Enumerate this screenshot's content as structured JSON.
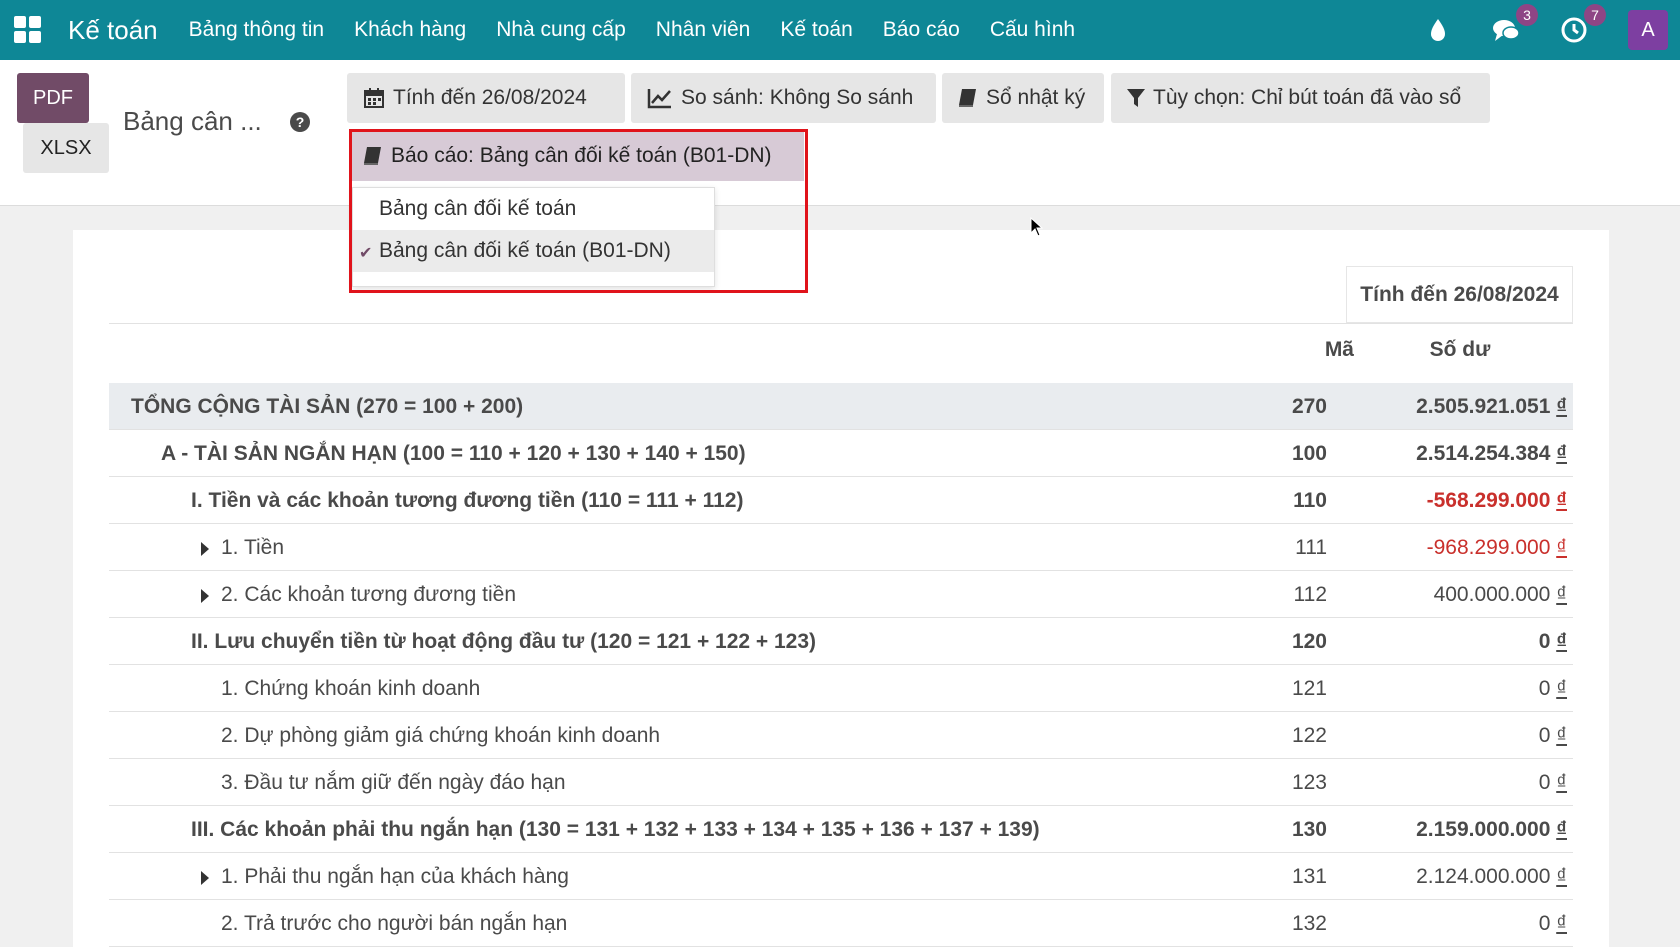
{
  "navbar": {
    "brand": "Kế toán",
    "menu": [
      "Bảng thông tin",
      "Khách hàng",
      "Nhà cung cấp",
      "Nhân viên",
      "Kế toán",
      "Báo cáo",
      "Cấu hình"
    ],
    "messages_badge": "3",
    "activities_badge": "7",
    "avatar_letter": "A"
  },
  "control": {
    "pdf_label": "PDF",
    "xlsx_label": "XLSX",
    "page_title": "Bảng cân ...",
    "help": "?",
    "date_filter": "Tính đến 26/08/2024",
    "comparison": "So sánh: Không So sánh",
    "journals": "Sổ nhật ký",
    "options": "Tùy chọn: Chỉ bút toán đã vào sổ",
    "report_selector": "Báo cáo: Bảng cân đối kế toán (B01-DN)"
  },
  "dropdown": {
    "items": [
      "Bảng cân đối kế toán",
      "Bảng cân đối kế toán (B01-DN)"
    ],
    "selected_index": 1
  },
  "report": {
    "column_date": "Tính đến 26/08/2024",
    "col_code": "Mã",
    "col_balance": "Số dư",
    "currency": "₫",
    "rows": [
      {
        "label": "TỔNG CỘNG TÀI SẢN (270 = 100 + 200)",
        "code": "270",
        "amount": "2.505.921.051",
        "style": "total",
        "indent": 0,
        "expandable": false,
        "negative": false
      },
      {
        "label": "A - TÀI SẢN NGẮN HẠN (100 = 110 + 120 + 130 + 140 + 150)",
        "code": "100",
        "amount": "2.514.254.384",
        "style": "bold",
        "indent": 1,
        "expandable": false,
        "negative": false
      },
      {
        "label": "I. Tiền và các khoản tương đương tiền (110 = 111 + 112)",
        "code": "110",
        "amount": "-568.299.000",
        "style": "bold",
        "indent": 2,
        "expandable": false,
        "negative": true
      },
      {
        "label": "1. Tiền",
        "code": "111",
        "amount": "-968.299.000",
        "style": "normal",
        "indent": 3,
        "expandable": true,
        "negative": true
      },
      {
        "label": "2. Các khoản tương đương tiền",
        "code": "112",
        "amount": "400.000.000",
        "style": "normal",
        "indent": 3,
        "expandable": true,
        "negative": false
      },
      {
        "label": "II. Lưu chuyển tiền từ hoạt động đầu tư (120 = 121 + 122 + 123)",
        "code": "120",
        "amount": "0",
        "style": "bold",
        "indent": 2,
        "expandable": false,
        "negative": false
      },
      {
        "label": "1. Chứng khoán kinh doanh",
        "code": "121",
        "amount": "0",
        "style": "normal",
        "indent": 3,
        "expandable": false,
        "negative": false
      },
      {
        "label": "2. Dự phòng giảm giá chứng khoán kinh doanh",
        "code": "122",
        "amount": "0",
        "style": "normal",
        "indent": 3,
        "expandable": false,
        "negative": false
      },
      {
        "label": "3. Đầu tư nắm giữ đến ngày đáo hạn",
        "code": "123",
        "amount": "0",
        "style": "normal",
        "indent": 3,
        "expandable": false,
        "negative": false
      },
      {
        "label": "III. Các khoản phải thu ngắn hạn (130 = 131 + 132 + 133 + 134 + 135 + 136 + 137 + 139)",
        "code": "130",
        "amount": "2.159.000.000",
        "style": "bold",
        "indent": 2,
        "expandable": false,
        "negative": false
      },
      {
        "label": "1. Phải thu ngắn hạn của khách hàng",
        "code": "131",
        "amount": "2.124.000.000",
        "style": "normal",
        "indent": 3,
        "expandable": true,
        "negative": false
      },
      {
        "label": "2. Trả trước cho người bán ngắn hạn",
        "code": "132",
        "amount": "0",
        "style": "normal",
        "indent": 3,
        "expandable": false,
        "negative": false
      }
    ]
  },
  "colors": {
    "navbar": "#0e8796",
    "primary": "#714b67",
    "negative": "#c9302c",
    "highlight": "#e0131b"
  }
}
